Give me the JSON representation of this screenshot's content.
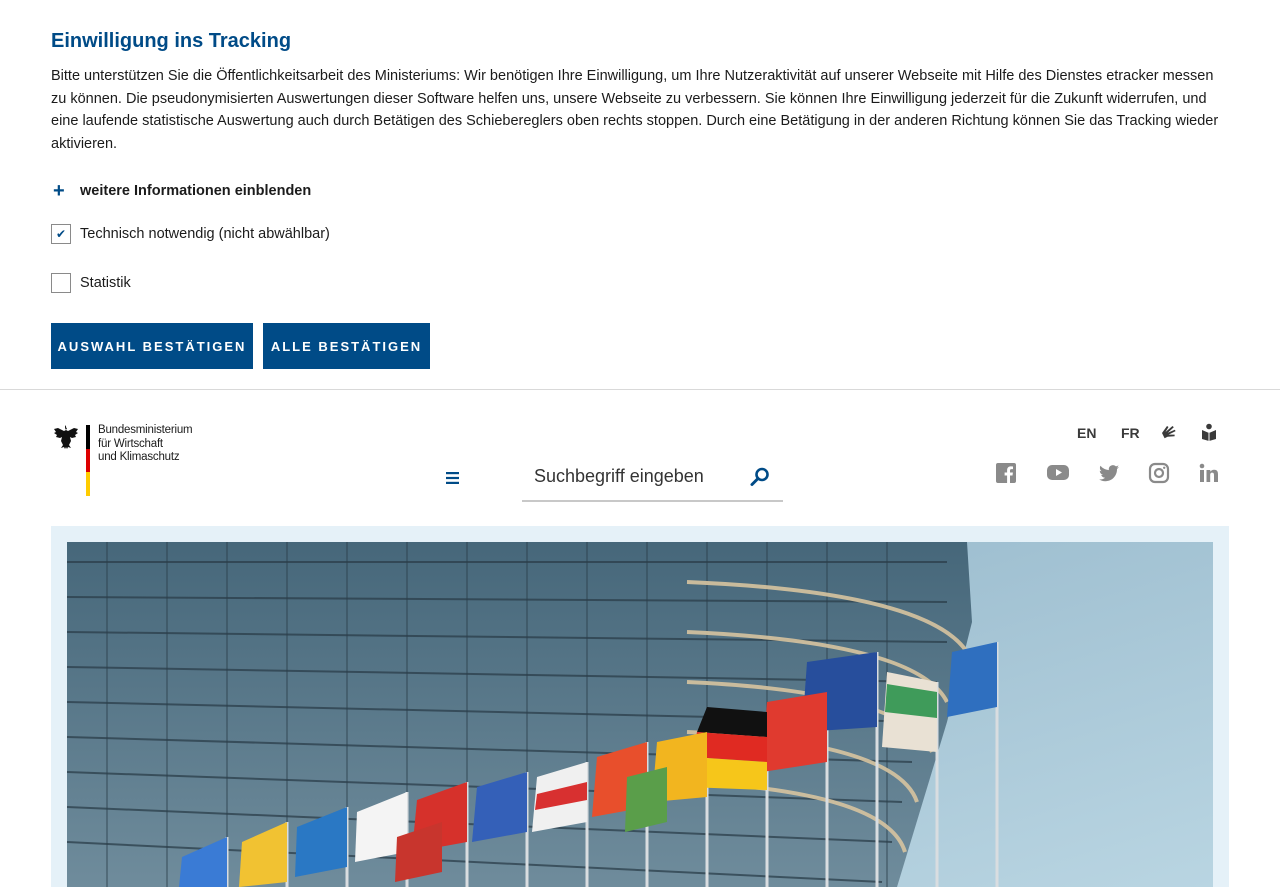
{
  "consent": {
    "title": "Einwilligung ins Tracking",
    "text": "Bitte unterstützen Sie die Öffentlichkeitsarbeit des Ministeriums: Wir benötigen Ihre Einwilligung, um Ihre Nutzeraktivität auf unserer Webseite mit Hilfe des Dienstes etracker messen zu können. Die pseudonymisierten Auswertungen dieser Software helfen uns, unsere Webseite zu verbessern. Sie können Ihre Einwilligung jederzeit für die Zukunft widerrufen, und eine laufende statistische Auswertung auch durch Betätigen des Schiebereglers oben rechts stoppen. Durch eine Betätigung in der anderen Richtung können Sie das Tracking wieder aktivieren.",
    "more_info": "weitere Informationen einblenden",
    "more_info_icon": "+",
    "options": [
      {
        "label": "Technisch notwendig (nicht abwählbar)",
        "checked": true,
        "mark": "✔"
      },
      {
        "label": "Statistik",
        "checked": false,
        "mark": ""
      }
    ],
    "confirm_selection": "AUSWAHL BESTÄTIGEN",
    "confirm_all": "ALLE BESTÄTIGEN"
  },
  "header": {
    "logo_text": "Bundesministerium\nfür Wirtschaft\nund Klimaschutz",
    "search_placeholder": "Suchbegriff eingeben",
    "languages": [
      "EN",
      "FR"
    ],
    "icons": {
      "sign_language": "sign-language-icon",
      "easy_language": "easy-language-icon",
      "menu": "menu-icon",
      "search": "search-icon"
    },
    "social": [
      "facebook-icon",
      "youtube-icon",
      "twitter-icon",
      "instagram-icon",
      "linkedin-icon"
    ]
  },
  "colors": {
    "brand_blue": "#004b87",
    "hero_background": "#e5f1f8",
    "social_gray": "#8a8a8a"
  }
}
